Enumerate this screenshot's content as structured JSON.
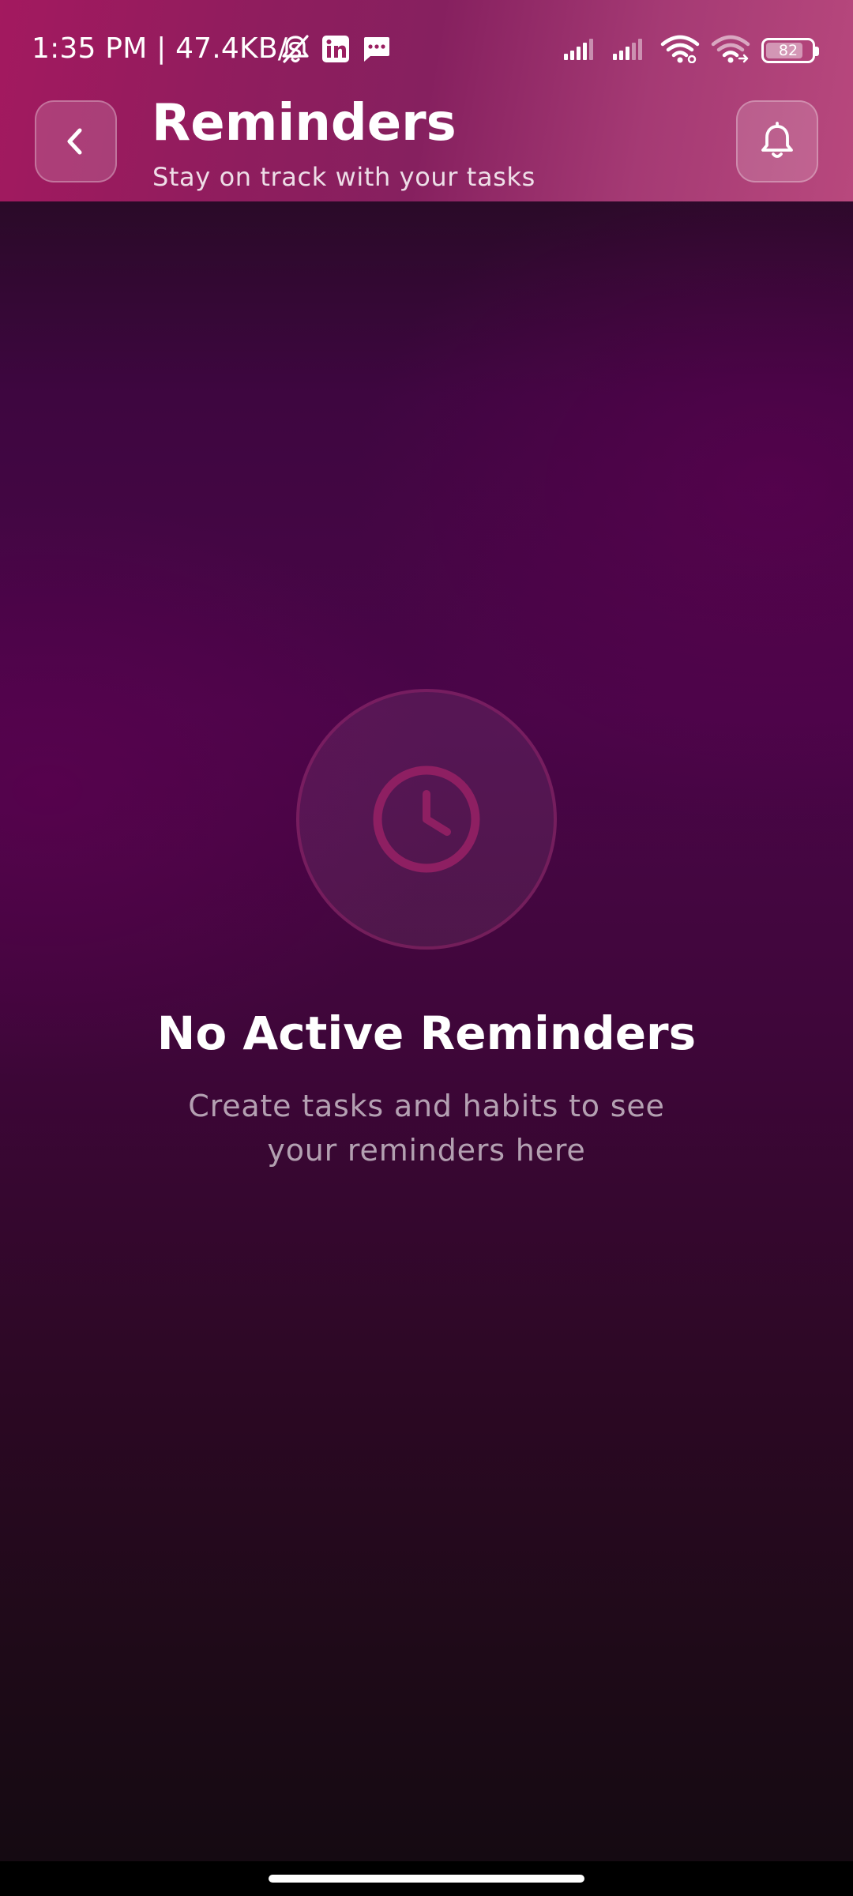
{
  "status_bar": {
    "time_and_speed": "1:35 PM | 47.4KB/s",
    "battery_level": "82",
    "battery_fraction": 0.82,
    "icons_left": [
      "bell-off-icon",
      "linkedin-icon",
      "message-icon"
    ],
    "icons_right": [
      "signal-icon",
      "signal-icon",
      "wifi-icon",
      "wifi-link-icon",
      "battery-icon"
    ]
  },
  "header": {
    "title": "Reminders",
    "subtitle": "Stay on track with your tasks",
    "back_icon": "chevron-left-icon",
    "action_icon": "bell-icon"
  },
  "empty_state": {
    "icon": "clock-icon",
    "title": "No Active Reminders",
    "description": "Create tasks and habits to see your reminders here"
  },
  "colors": {
    "header_start": "#a3195f",
    "header_end": "#b8487d",
    "background_mid": "#4a0548",
    "background_bottom": "#150a12",
    "clock_accent": "#8e1f62"
  }
}
